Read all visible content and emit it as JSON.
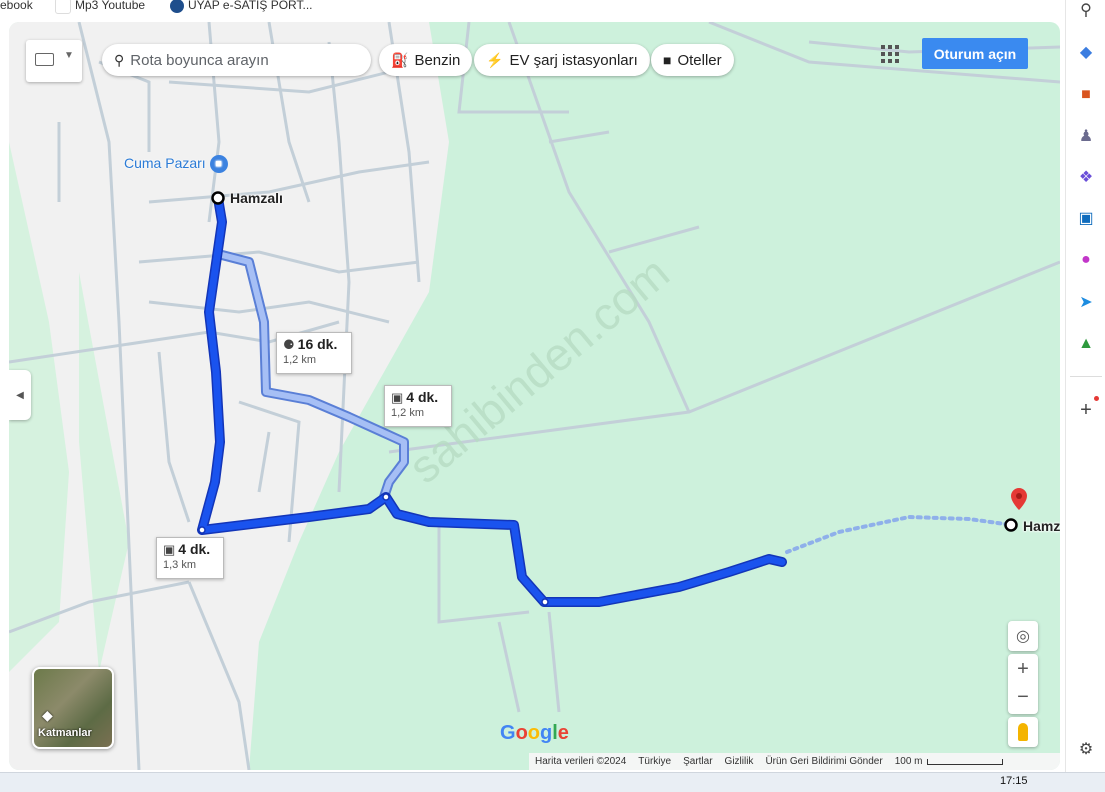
{
  "bookmarks": [
    {
      "label": "ebook",
      "color": "#1877f2"
    },
    {
      "label": "Mp3 Youtube",
      "color": "#ffffff"
    },
    {
      "label": "UYAP e-SATIŞ PORT...",
      "color": "#1f4e8c"
    }
  ],
  "map": {
    "keyboard_icon": "keyboard-icon",
    "search": {
      "placeholder": "Rota boyunca arayın"
    },
    "chips": [
      {
        "label": "Benzin",
        "icon": "gas-station-icon"
      },
      {
        "label": "EV şarj istasyonları",
        "icon": "ev-charger-icon"
      },
      {
        "label": "Oteller",
        "icon": "hotel-icon"
      }
    ],
    "signin_label": "Oturum açın",
    "poi_cuma_pazari": "Cuma Pazarı",
    "origin_label": "Hamzalı",
    "destination_label": "Hamz",
    "watermark": "sahibinden.com",
    "callouts": [
      {
        "mode": "walk",
        "time": "16 dk.",
        "distance": "1,2 km"
      },
      {
        "mode": "car",
        "time": "4 dk.",
        "distance": "1,2 km"
      },
      {
        "mode": "car",
        "time": "4 dk.",
        "distance": "1,3 km"
      }
    ],
    "layers_label": "Katmanlar",
    "google_logo": "Google",
    "footer": {
      "data": "Harita verileri ©2024",
      "country": "Türkiye",
      "terms": "Şartlar",
      "privacy": "Gizlilik",
      "feedback": "Ürün Geri Bildirimi Gönder",
      "scale": "100 m"
    },
    "colors": {
      "route_primary": "#1a53ee",
      "route_alt": "#a6bff5",
      "land": "#cdf1dc",
      "town": "#f1f1f1",
      "accent": "#3a8af0",
      "pin": "#e53935"
    }
  },
  "sidebar_icons": [
    "search-icon",
    "tag-icon",
    "briefcase-icon",
    "chess-icon",
    "copilot-icon",
    "outlook-icon",
    "designer-icon",
    "send-icon",
    "tree-icon",
    "add-icon",
    "settings-icon"
  ],
  "taskbar": {
    "time": "17:15"
  }
}
